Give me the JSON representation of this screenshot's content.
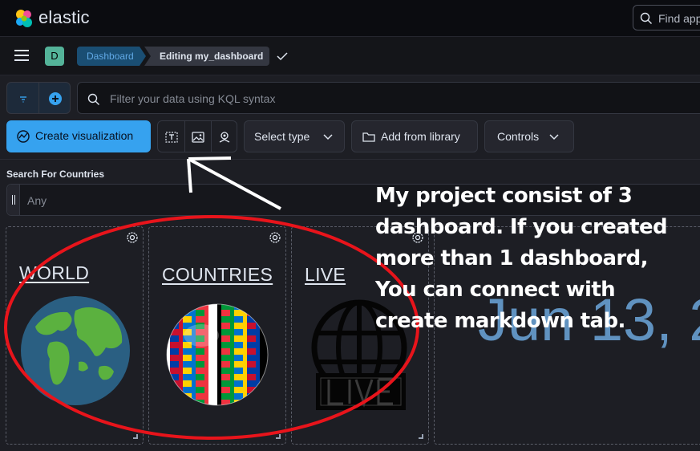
{
  "header": {
    "brand": "elastic",
    "search_placeholder": "Find app"
  },
  "breadcrumb": {
    "avatar_letter": "D",
    "items": [
      "Dashboard",
      "Editing my_dashboard"
    ]
  },
  "query": {
    "placeholder": "Filter your data using KQL syntax"
  },
  "toolbar": {
    "create_visualization": "Create visualization",
    "select_type": "Select type",
    "add_from_library": "Add from library",
    "controls": "Controls"
  },
  "controls": {
    "title": "Search For Countries",
    "placeholder": "Any"
  },
  "panels": [
    {
      "title": "WORLD",
      "image": "earth-globe-icon"
    },
    {
      "title": "COUNTRIES",
      "image": "flags-globe-icon"
    },
    {
      "title": "LIVE",
      "image": "live-globe-icon"
    }
  ],
  "date_panel": {
    "text": "Jun 13, 2"
  },
  "annotation": {
    "text": "My project consist of 3 dashboard. If you created more than 1 dashboard, You can connect with create markdown tab.",
    "lines": [
      "My project consist of 3",
      "dashboard. If you created",
      "more than 1 dashboard,",
      "You can connect with",
      "create markdown tab."
    ],
    "ellipse_color": "#e8141b",
    "arrow_color": "#ffffff"
  },
  "colors": {
    "accent": "#36a2ef",
    "background": "#1d1e24",
    "header": "#0b0c10"
  }
}
